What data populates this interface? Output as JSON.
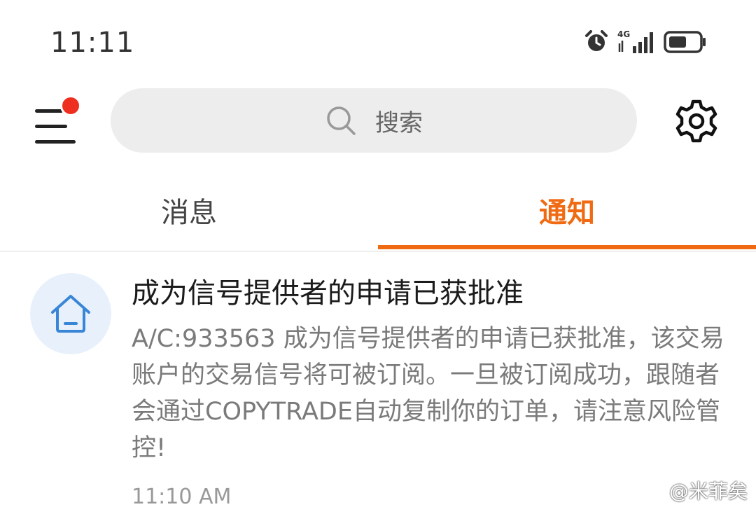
{
  "status_bar": {
    "time": "11:11",
    "network": "4G",
    "icons": [
      "alarm-icon",
      "signal-icon",
      "battery-icon"
    ]
  },
  "toolbar": {
    "menu_icon": "menu-icon",
    "has_unread_badge": true,
    "search_placeholder": "搜索",
    "settings_icon": "gear-icon"
  },
  "tabs": [
    {
      "label": "消息",
      "active": false
    },
    {
      "label": "通知",
      "active": true
    }
  ],
  "notice": {
    "icon": "home-icon",
    "title": "成为信号提供者的申请已获批准",
    "body": "A/C:933563 成为信号提供者的申请已获批准，该交易账户的交易信号将可被订阅。一旦被订阅成功，跟随者会通过COPYTRADE自动复制你的订单，请注意风险管控!",
    "time": "11:10 AM"
  },
  "watermark": "@米菲矣",
  "colors": {
    "accent": "#ef6a12",
    "badge": "#ee2f1f",
    "search_bg": "#ededed",
    "icon_blue": "#3a86d6",
    "avatar_bg": "#e8f1fb"
  }
}
